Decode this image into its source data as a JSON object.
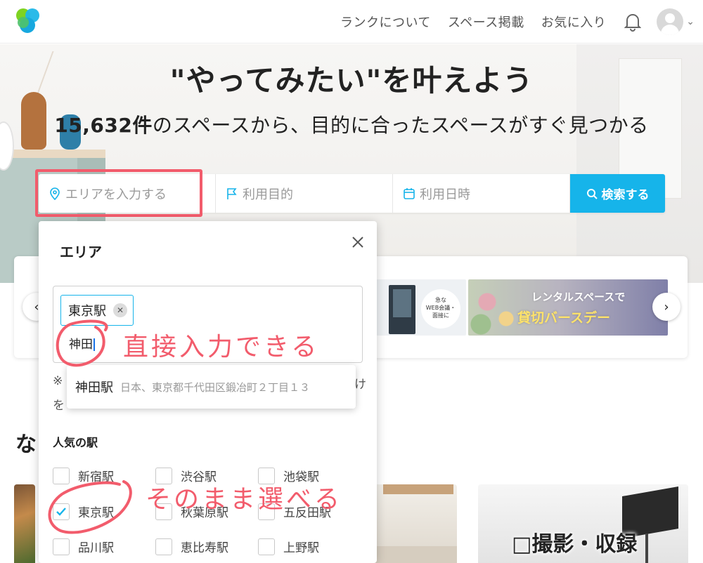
{
  "header": {
    "nav": [
      {
        "label": "ランクについて"
      },
      {
        "label": "スペース掲載"
      },
      {
        "label": "お気に入り"
      }
    ],
    "brand_color": "#16b4ea"
  },
  "hero": {
    "title": "\"やってみたい\"を叶えよう",
    "sub_count": "15,632件",
    "sub_rest": "のスペースから、目的に合ったスペースがすぐ見つかる"
  },
  "search": {
    "area_placeholder": "エリアを入力する",
    "purpose_placeholder": "利用目的",
    "date_placeholder": "利用日時",
    "button_label": "検索する",
    "button_color": "#16b4ea"
  },
  "banners": {
    "banner1_text": [
      "急な",
      "WEB会議・",
      "面接に"
    ],
    "banner2_line1": "レンタルスペースで",
    "banner2_line2": "貸切バースデー"
  },
  "section": {
    "title_partial": "な"
  },
  "card3_label": "□撮影・収録",
  "modal": {
    "title": "エリア",
    "chip_label": "東京駅",
    "typed_text": "神田",
    "hint_partial_1": "※",
    "hint_partial_2": "を",
    "hint_partial_3": "け",
    "suggestion": {
      "name": "神田駅",
      "address": "日本、東京都千代田区鍛冶町２丁目１３"
    },
    "popular_title": "人気の駅",
    "stations": [
      [
        {
          "label": "新宿駅",
          "checked": false
        },
        {
          "label": "渋谷駅",
          "checked": false
        },
        {
          "label": "池袋駅",
          "checked": false
        }
      ],
      [
        {
          "label": "東京駅",
          "checked": true
        },
        {
          "label": "秋葉原駅",
          "checked": false
        },
        {
          "label": "五反田駅",
          "checked": false
        }
      ],
      [
        {
          "label": "品川駅",
          "checked": false
        },
        {
          "label": "恵比寿駅",
          "checked": false
        },
        {
          "label": "上野駅",
          "checked": false
        }
      ]
    ]
  },
  "annotations": {
    "note1": "直接入力できる",
    "note2": "そのまま選べる",
    "color": "#f25c6c"
  }
}
